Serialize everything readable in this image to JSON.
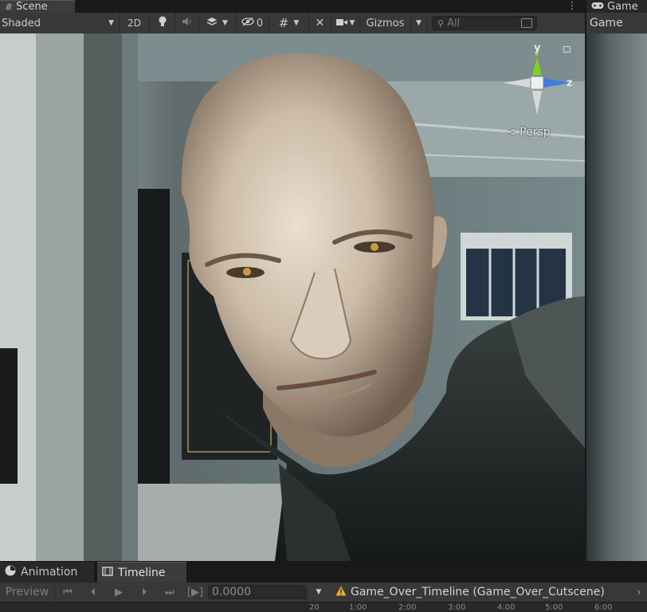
{
  "tabs": {
    "scene": {
      "label": "Scene",
      "icon": "hash-icon"
    },
    "game": {
      "label": "Game",
      "icon": "gamepad-icon"
    }
  },
  "toolbar": {
    "draw_mode": "Shaded",
    "mode_2d": "2D",
    "hidden_count": "0",
    "gizmos": "Gizmos",
    "search_placeholder": "All"
  },
  "game_toolbar": {
    "display": "Game"
  },
  "gizmo": {
    "y_label": "y",
    "z_label": "z",
    "projection": "Persp"
  },
  "bottom_tabs": {
    "animation": "Animation",
    "timeline": "Timeline"
  },
  "timeline": {
    "preview": "Preview",
    "current_time": "0.0000",
    "asset_name": "Game_Over_Timeline (Game_Over_Cutscene)",
    "ruler_ticks": [
      "20",
      "1:00",
      "2:00",
      "3:00",
      "4:00",
      "5:00",
      "6:00"
    ]
  },
  "colors": {
    "axis_y": "#7ed321",
    "axis_z": "#3d7fe0",
    "axis_neutral": "#d8d8d8",
    "warning": "#e6b422",
    "panel": "#383838"
  }
}
